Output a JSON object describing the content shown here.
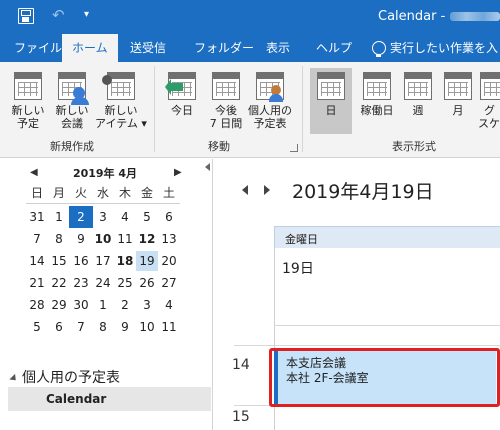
{
  "titlebar": {
    "title": "Calendar - ",
    "icons": [
      "save-icon",
      "undo-icon",
      "customize-qat-icon"
    ]
  },
  "tabs": [
    {
      "label": "ファイル"
    },
    {
      "label": "ホーム",
      "active": true
    },
    {
      "label": "送受信"
    },
    {
      "label": "フォルダー"
    },
    {
      "label": "表示"
    },
    {
      "label": "ヘルプ"
    }
  ],
  "tell_me": "実行したい作業を入",
  "ribbon": {
    "new_group": {
      "label": "新規作成",
      "buttons": [
        {
          "line1": "新しい",
          "line2": "予定"
        },
        {
          "line1": "新しい",
          "line2": "会議"
        },
        {
          "line1": "新しい",
          "line2": "アイテム ▾"
        }
      ]
    },
    "goto_group": {
      "label": "移動",
      "buttons": [
        {
          "line1": "今日",
          "line2": ""
        },
        {
          "line1": "今後",
          "line2": "7 日間"
        },
        {
          "line1": "個人用の",
          "line2": "予定表"
        }
      ]
    },
    "view_group": {
      "label": "表示形式",
      "buttons": [
        {
          "line1": "日",
          "line2": ""
        },
        {
          "line1": "稼働日",
          "line2": ""
        },
        {
          "line1": "週",
          "line2": ""
        },
        {
          "line1": "月",
          "line2": ""
        },
        {
          "line1": "グ",
          "line2": "スケ"
        }
      ]
    }
  },
  "mini_calendar": {
    "title": "2019年 4月",
    "weekdays": [
      "日",
      "月",
      "火",
      "水",
      "木",
      "金",
      "土"
    ],
    "weeks": [
      [
        "31",
        "1",
        "2",
        "3",
        "4",
        "5",
        "6"
      ],
      [
        "7",
        "8",
        "9",
        "10",
        "11",
        "12",
        "13"
      ],
      [
        "14",
        "15",
        "16",
        "17",
        "18",
        "19",
        "20"
      ],
      [
        "21",
        "22",
        "23",
        "24",
        "25",
        "26",
        "27"
      ],
      [
        "28",
        "29",
        "30",
        "1",
        "2",
        "3",
        "4"
      ],
      [
        "5",
        "6",
        "7",
        "8",
        "9",
        "10",
        "11"
      ]
    ],
    "today": "2",
    "selected": "19",
    "bold_days": [
      "10",
      "12",
      "18"
    ]
  },
  "folders": {
    "group_label": "個人用の予定表",
    "items": [
      {
        "label": "Calendar"
      }
    ]
  },
  "main": {
    "date_heading": "2019年4月19日",
    "weekday": "金曜日",
    "day_number": "19日",
    "hours": [
      "14",
      "15"
    ],
    "appointment": {
      "title": "本支店会議",
      "location": "本社 2F-会議室",
      "color": "#c6e3f9"
    }
  },
  "colors": {
    "accent": "#1b6ec2",
    "highlight": "#e02020"
  }
}
